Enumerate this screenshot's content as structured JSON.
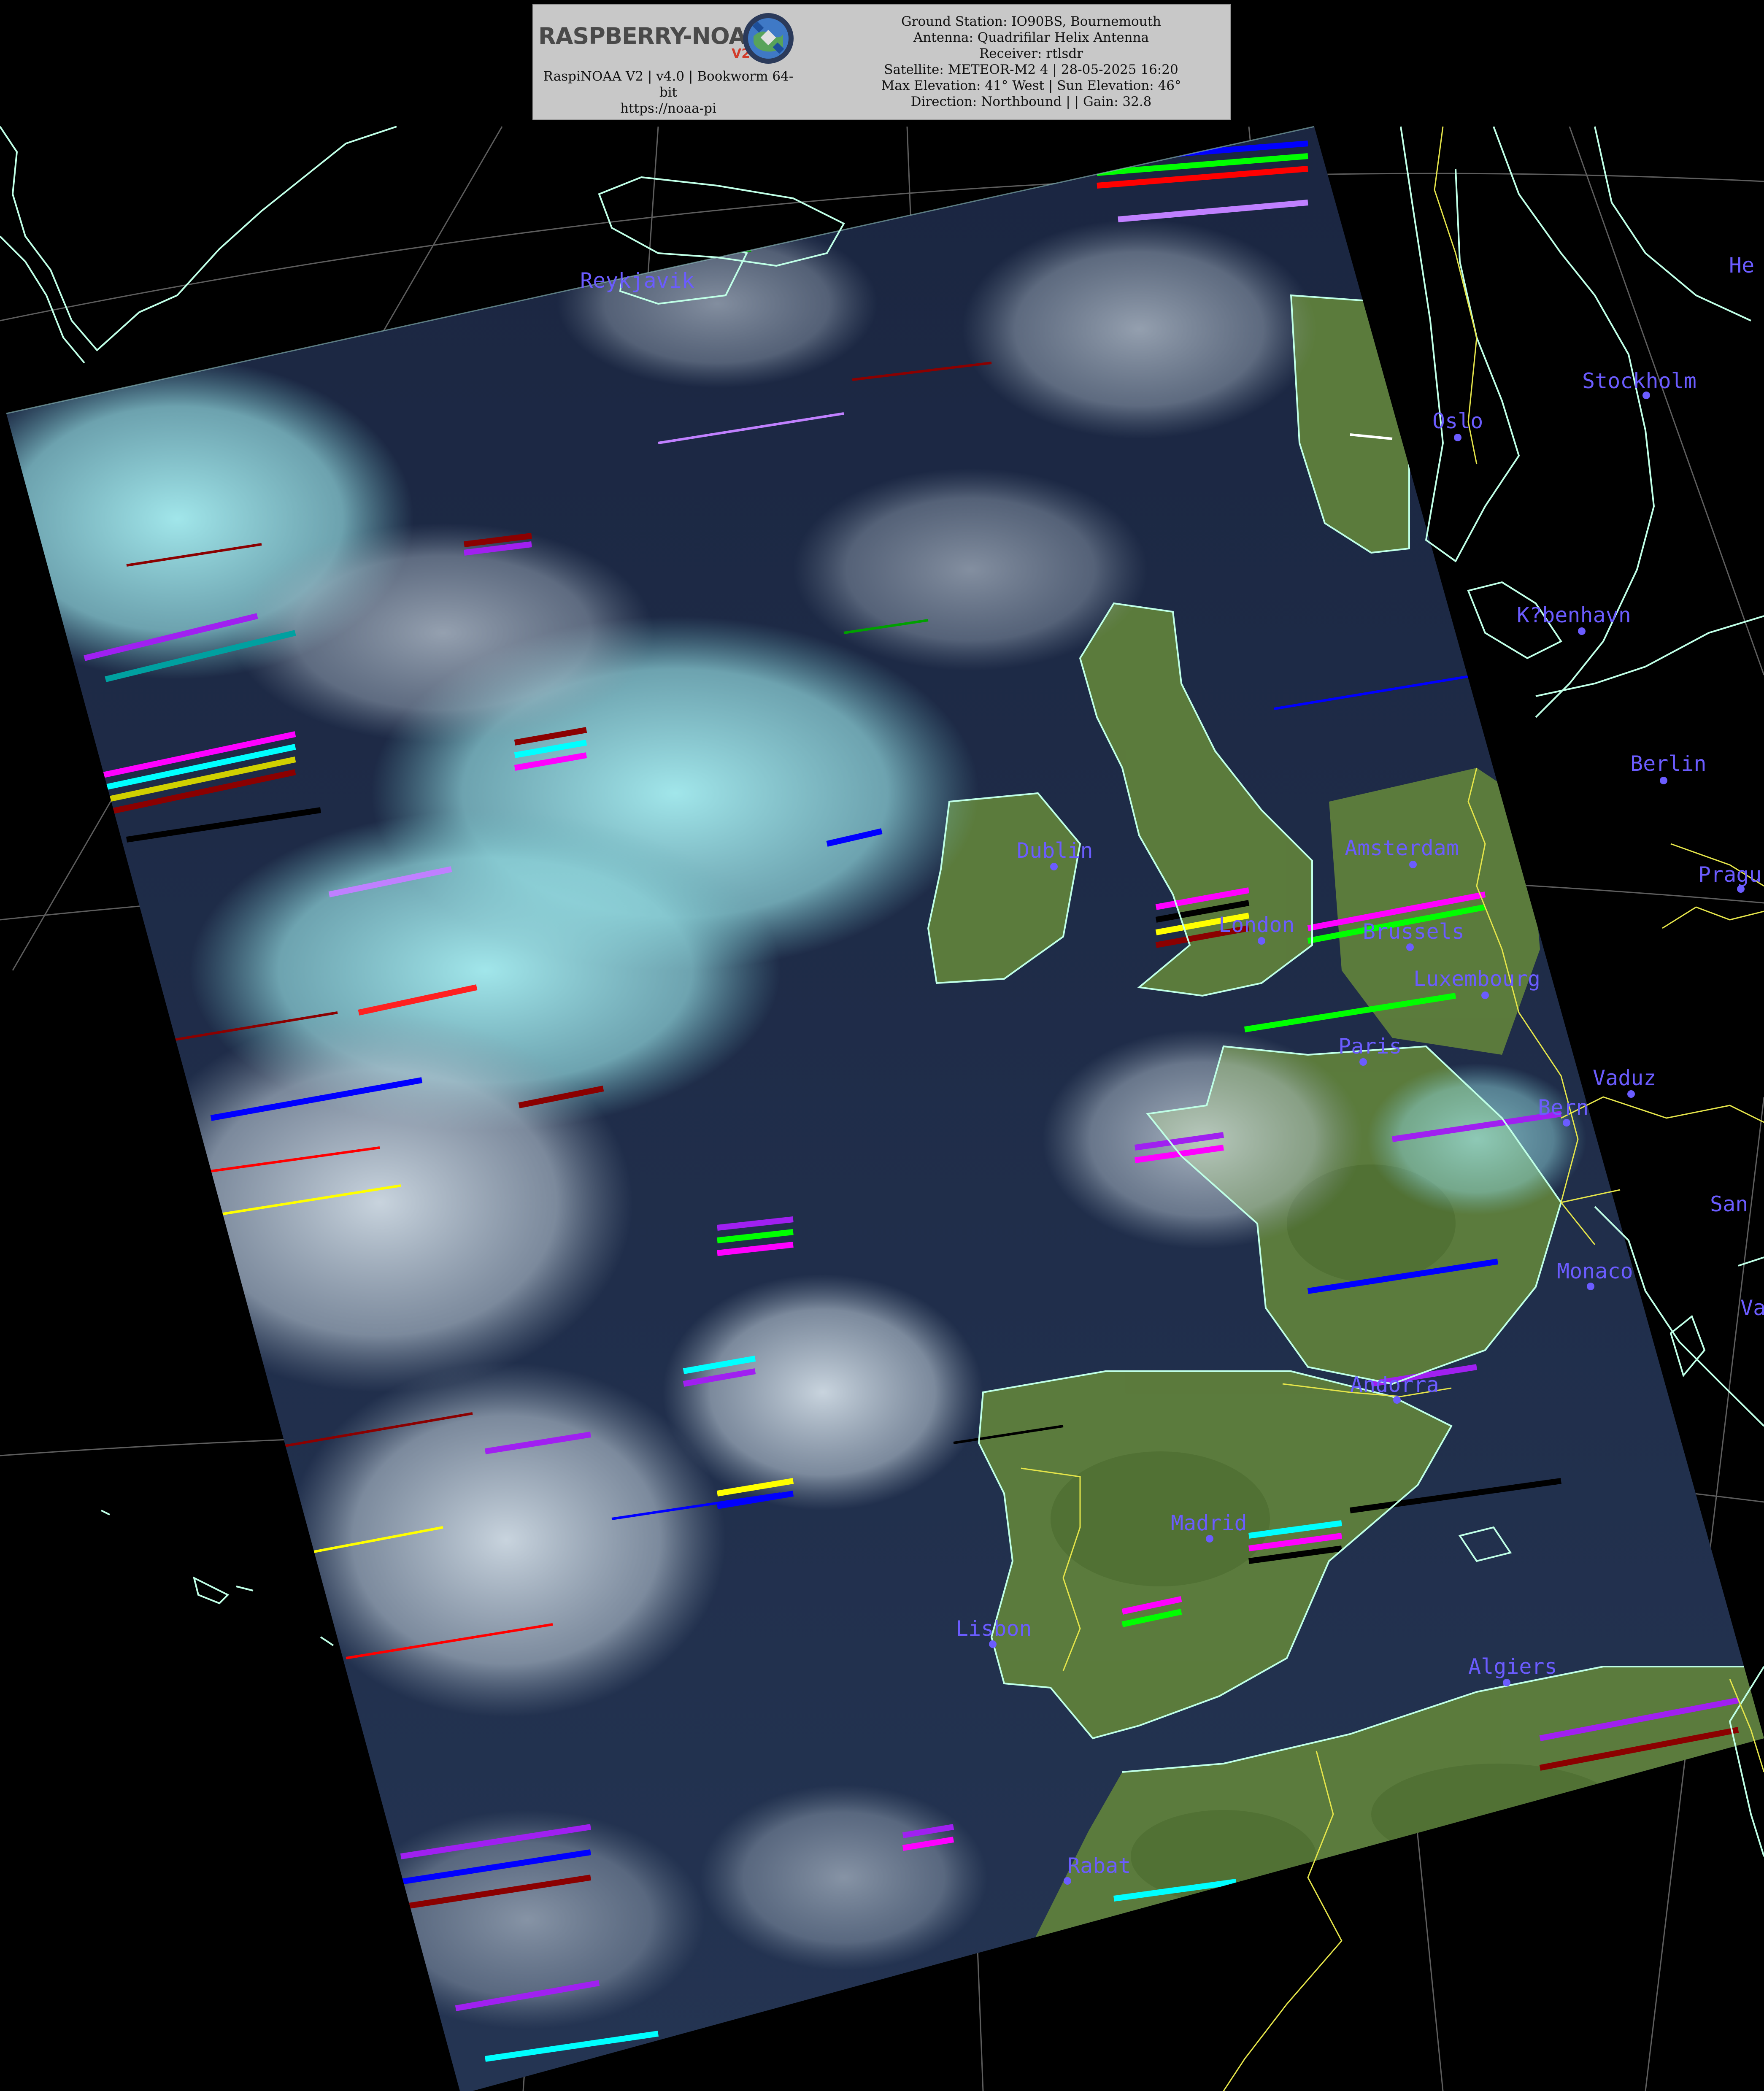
{
  "header": {
    "logo_text": "RASPBERRY-NOAA",
    "logo_version_mark": "V2",
    "logo_caption": [
      "RaspiNOAA V2 | v4.0 | Bookworm 64-",
      "bit",
      "https://noaa-pi"
    ],
    "station_lines": [
      "Ground Station: IO90BS, Bournemouth",
      "Antenna: Quadrifilar Helix Antenna",
      "Receiver: rtlsdr",
      "Satellite: METEOR-M2 4 | 28-05-2025 16:20",
      "Max Elevation: 41° West | Sun Elevation: 46°",
      "Direction: Northbound | | Gain: 32.8"
    ]
  },
  "colors": {
    "background": "#000000",
    "city_label": "#6b5cff",
    "coastline": "#bfffe6",
    "border": "#e5e54a",
    "graticule": "#6e6e6e",
    "cloud": "#9fe6ea",
    "ocean": "#1c2a45",
    "land": "#5f7f3c"
  },
  "cities": [
    {
      "name": "Reykjavik",
      "label": "Reykjavik"
    },
    {
      "name": "Stockholm",
      "label": "Stockholm"
    },
    {
      "name": "Oslo",
      "label": "Oslo"
    },
    {
      "name": "Kobenhavn",
      "label": "K?benhavn"
    },
    {
      "name": "Berlin",
      "label": "Berlin"
    },
    {
      "name": "Dublin",
      "label": "Dublin"
    },
    {
      "name": "Amsterdam",
      "label": "Amsterdam"
    },
    {
      "name": "Prague",
      "label": "Pragu"
    },
    {
      "name": "London",
      "label": "London"
    },
    {
      "name": "Brussels",
      "label": "Brussels"
    },
    {
      "name": "Luxembourg",
      "label": "Luxembourg"
    },
    {
      "name": "Paris",
      "label": "Paris"
    },
    {
      "name": "Vaduz",
      "label": "Vaduz"
    },
    {
      "name": "Bern",
      "label": "Bern"
    },
    {
      "name": "San",
      "label": "San"
    },
    {
      "name": "Monaco",
      "label": "Monaco"
    },
    {
      "name": "Andorra",
      "label": "Andorra"
    },
    {
      "name": "Madrid",
      "label": "Madrid"
    },
    {
      "name": "Lisbon",
      "label": "Lisbon"
    },
    {
      "name": "Algiers",
      "label": "Algiers"
    },
    {
      "name": "Rabat",
      "label": "Rabat"
    },
    {
      "name": "Helsinki",
      "label": "He"
    },
    {
      "name": "Vatican",
      "label": "Va"
    }
  ]
}
